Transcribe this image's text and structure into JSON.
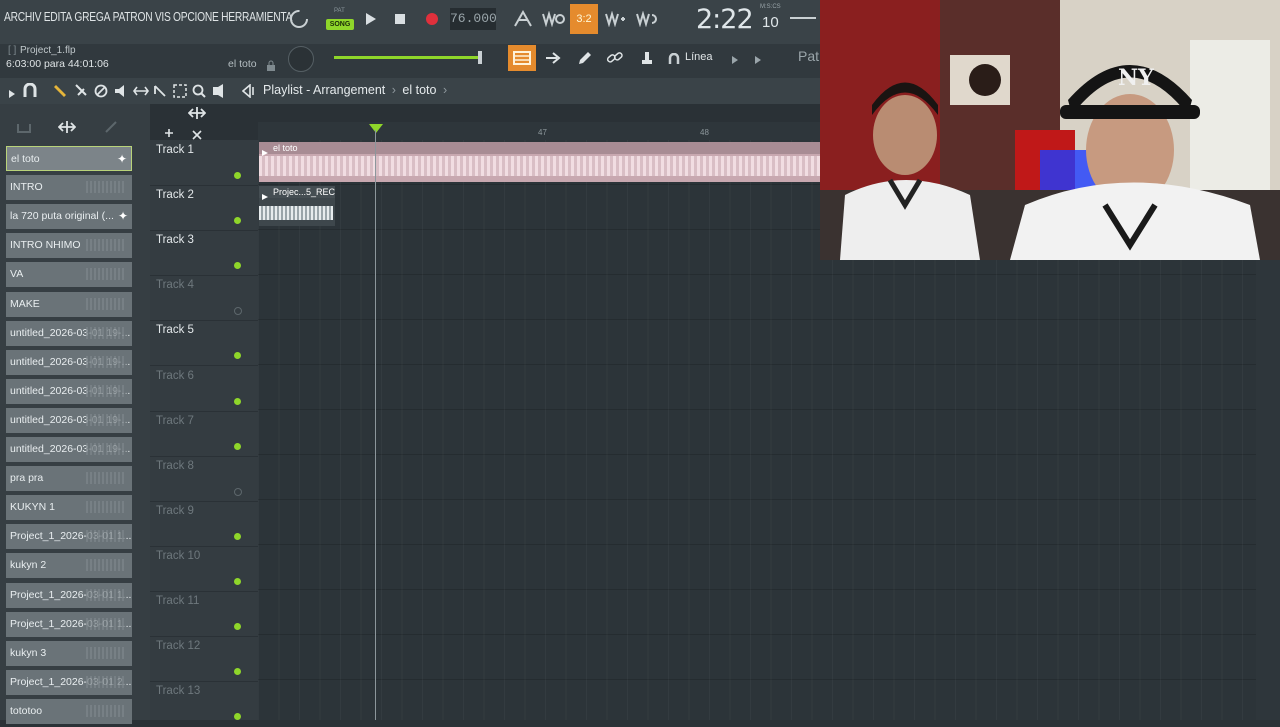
{
  "menu": [
    "ARCHIV",
    "EDITA",
    "GREGA",
    "PATRON",
    "VIS",
    "OPCIONE",
    "HERRAMIENTA"
  ],
  "transport": {
    "pat_label": "PAT",
    "song_label": "SONG",
    "tempo": "76.000",
    "snap_value": "3:2"
  },
  "clock": {
    "main": "2:22",
    "small": "10",
    "unit": "M:S:CS"
  },
  "project": {
    "filename": "Project_1.flp",
    "bracket": "[ ]",
    "time_info": "6:03:00 para 44:01:06",
    "current_pattern": "el toto"
  },
  "toolbar2": {
    "line_label": "Línea",
    "pattern_label": "Pat"
  },
  "playlist": {
    "title": "Playlist - Arrangement",
    "pattern": "el toto",
    "sep": "›"
  },
  "ruler": {
    "marks": [
      "47",
      "48"
    ]
  },
  "patterns": [
    "el toto",
    "INTRO",
    "la 720 puta original (...",
    "INTRO NHIMO",
    "VA",
    "MAKE",
    "untitled_2026-03-01 19-...",
    "untitled_2026-03-01 19-...",
    "untitled_2026-03-01 19-...",
    "untitled_2026-03-01 19-...",
    "untitled_2026-03-01 19-...",
    "pra pra",
    "KUKYN 1",
    "Project_1_2026-03-01 1...",
    "kukyn 2",
    "Project_1_2026-03-01 1...",
    "Project_1_2026-03-01 1...",
    "kukyn 3",
    "Project_1_2026-03-01 2...",
    "tototoo"
  ],
  "tracks": [
    {
      "name": "Track 1",
      "active": true
    },
    {
      "name": "Track 2",
      "active": true
    },
    {
      "name": "Track 3",
      "active": true
    },
    {
      "name": "Track 4",
      "active": false
    },
    {
      "name": "Track 5",
      "active": true
    },
    {
      "name": "Track 6",
      "active": true
    },
    {
      "name": "Track 7",
      "active": true
    },
    {
      "name": "Track 8",
      "active": false
    },
    {
      "name": "Track 9",
      "active": true
    },
    {
      "name": "Track 10",
      "active": true
    },
    {
      "name": "Track 11",
      "active": true
    },
    {
      "name": "Track 12",
      "active": true
    },
    {
      "name": "Track 13",
      "active": true
    }
  ],
  "clips": [
    {
      "track": 1,
      "label": "el toto"
    },
    {
      "track": 2,
      "label": "Projec...5_REC"
    }
  ],
  "webcam": {
    "cap_logo": "NY"
  },
  "colors": {
    "accent_green": "#8fd62a",
    "accent_orange": "#e58b2d",
    "clip_pink": "#c8a8b0"
  }
}
